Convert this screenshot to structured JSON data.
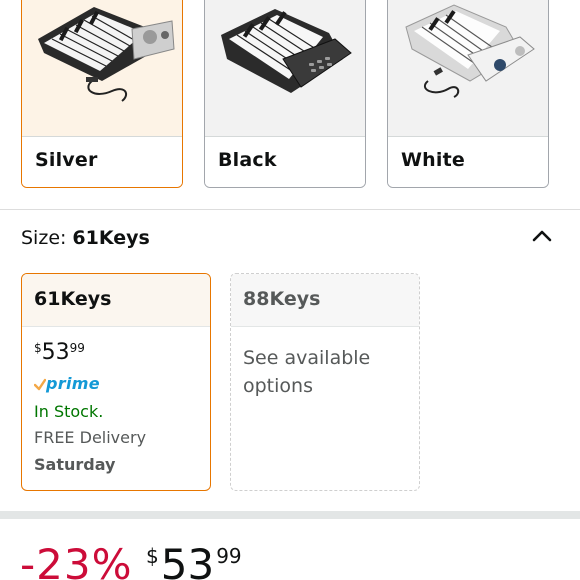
{
  "colors": {
    "accent_orange": "#e77600",
    "in_stock_green": "#007600",
    "prime_blue": "#1399d6",
    "discount_red": "#cc0c39"
  },
  "color_swatches": [
    {
      "label": "Silver",
      "selected": true,
      "image": "silver-roll-up-piano"
    },
    {
      "label": "Black",
      "selected": false,
      "image": "black-roll-up-piano"
    },
    {
      "label": "White",
      "selected": false,
      "image": "white-roll-up-piano"
    }
  ],
  "size": {
    "key_label": "Size:",
    "selected_value": "61Keys",
    "collapse_icon": "chevron-up-icon"
  },
  "size_options": [
    {
      "title": "61Keys",
      "selected": true,
      "price_currency": "$",
      "price_whole": "53",
      "price_fraction": "99",
      "prime_label": "prime",
      "stock": "In Stock.",
      "delivery_label": "FREE Delivery",
      "delivery_day": "Saturday"
    },
    {
      "title": "88Keys",
      "selected": false,
      "availability_text": "See available options"
    }
  ],
  "price_block": {
    "discount": "-23%",
    "currency": "$",
    "whole": "53",
    "fraction": "99"
  }
}
